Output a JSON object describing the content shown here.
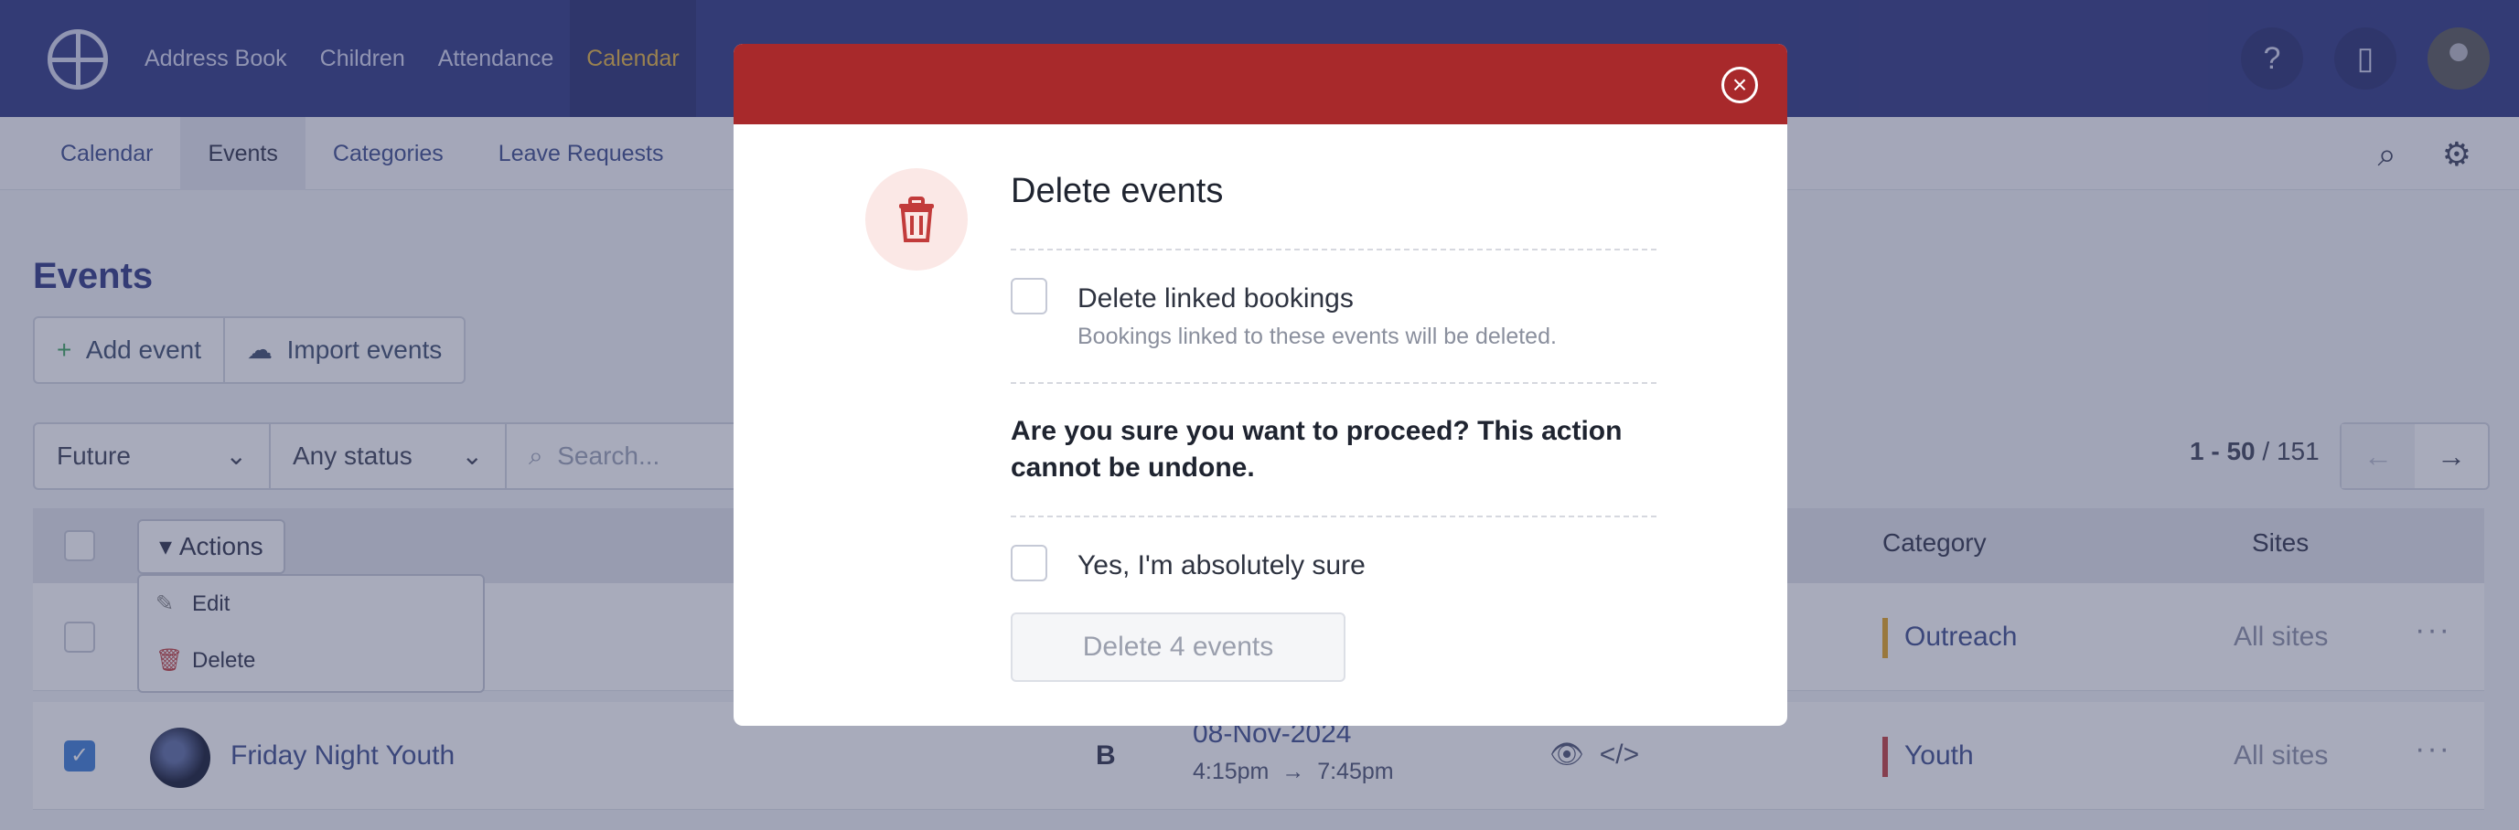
{
  "topnav": {
    "items": [
      "Address Book",
      "Children",
      "Attendance",
      "Calendar"
    ],
    "active": "Calendar",
    "help_icon": "question-circle-icon",
    "building_icon": "building-icon"
  },
  "subnav": {
    "items": [
      "Calendar",
      "Events",
      "Categories",
      "Leave Requests"
    ],
    "active": "Events"
  },
  "page": {
    "title": "Events",
    "add_event": "Add event",
    "import_events": "Import events",
    "filter_time": "Future",
    "filter_status": "Any status",
    "search_placeholder": "Search...",
    "pager_range": "1 - 50",
    "pager_total": "/ 151",
    "prev_arrow": "←",
    "next_arrow": "→"
  },
  "table": {
    "actions_label": "Actions",
    "col_category": "Category",
    "col_sites": "Sites",
    "actions_menu": {
      "edit": "Edit",
      "delete": "Delete"
    },
    "rows": [
      {
        "category": "Outreach",
        "category_color": "#e3a21a",
        "sites": "All sites",
        "more": "···"
      },
      {
        "name": "Friday Night Youth",
        "badge": "B",
        "date": "08-Nov-2024",
        "start": "4:15pm",
        "arrow": "→",
        "end": "7:45pm",
        "category": "Youth",
        "category_color": "#c23b3b",
        "sites": "All sites",
        "more": "···"
      }
    ]
  },
  "modal": {
    "header_color": "#a8292b",
    "close_icon": "close-circle-icon",
    "danger_icon": "trash-icon",
    "title": "Delete events",
    "linked_label": "Delete linked bookings",
    "linked_help": "Bookings linked to these events will be deleted.",
    "warning": "Are you sure you want to proceed? This action cannot be undone.",
    "confirm_label": "Yes, I'm absolutely sure",
    "submit_label": "Delete 4 events"
  }
}
